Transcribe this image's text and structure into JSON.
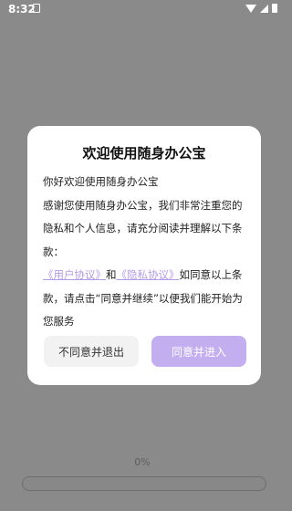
{
  "status_bar": {
    "time": "8:32"
  },
  "dialog": {
    "title": "欢迎使用随身办公宝",
    "greeting": "你好欢迎使用随身办公宝",
    "body": "感谢您使用随身办公宝，我们非常注重您的隐私和个人信息，请充分阅读并理解以下条款：",
    "user_agreement_link": "《用户协议》",
    "and_text": "和",
    "privacy_policy_link": "《隐私协议》",
    "consent_text": "如同意以上条款，请点击“同意并继续”以便我们能开始为您服务",
    "decline_label": "不同意并退出",
    "accept_label": "同意并进入"
  },
  "progress": {
    "value_label": "0%",
    "value": 0
  },
  "colors": {
    "accent": "#c3aff0",
    "link": "#b49ae8",
    "overlay": "#8a8a8a"
  }
}
